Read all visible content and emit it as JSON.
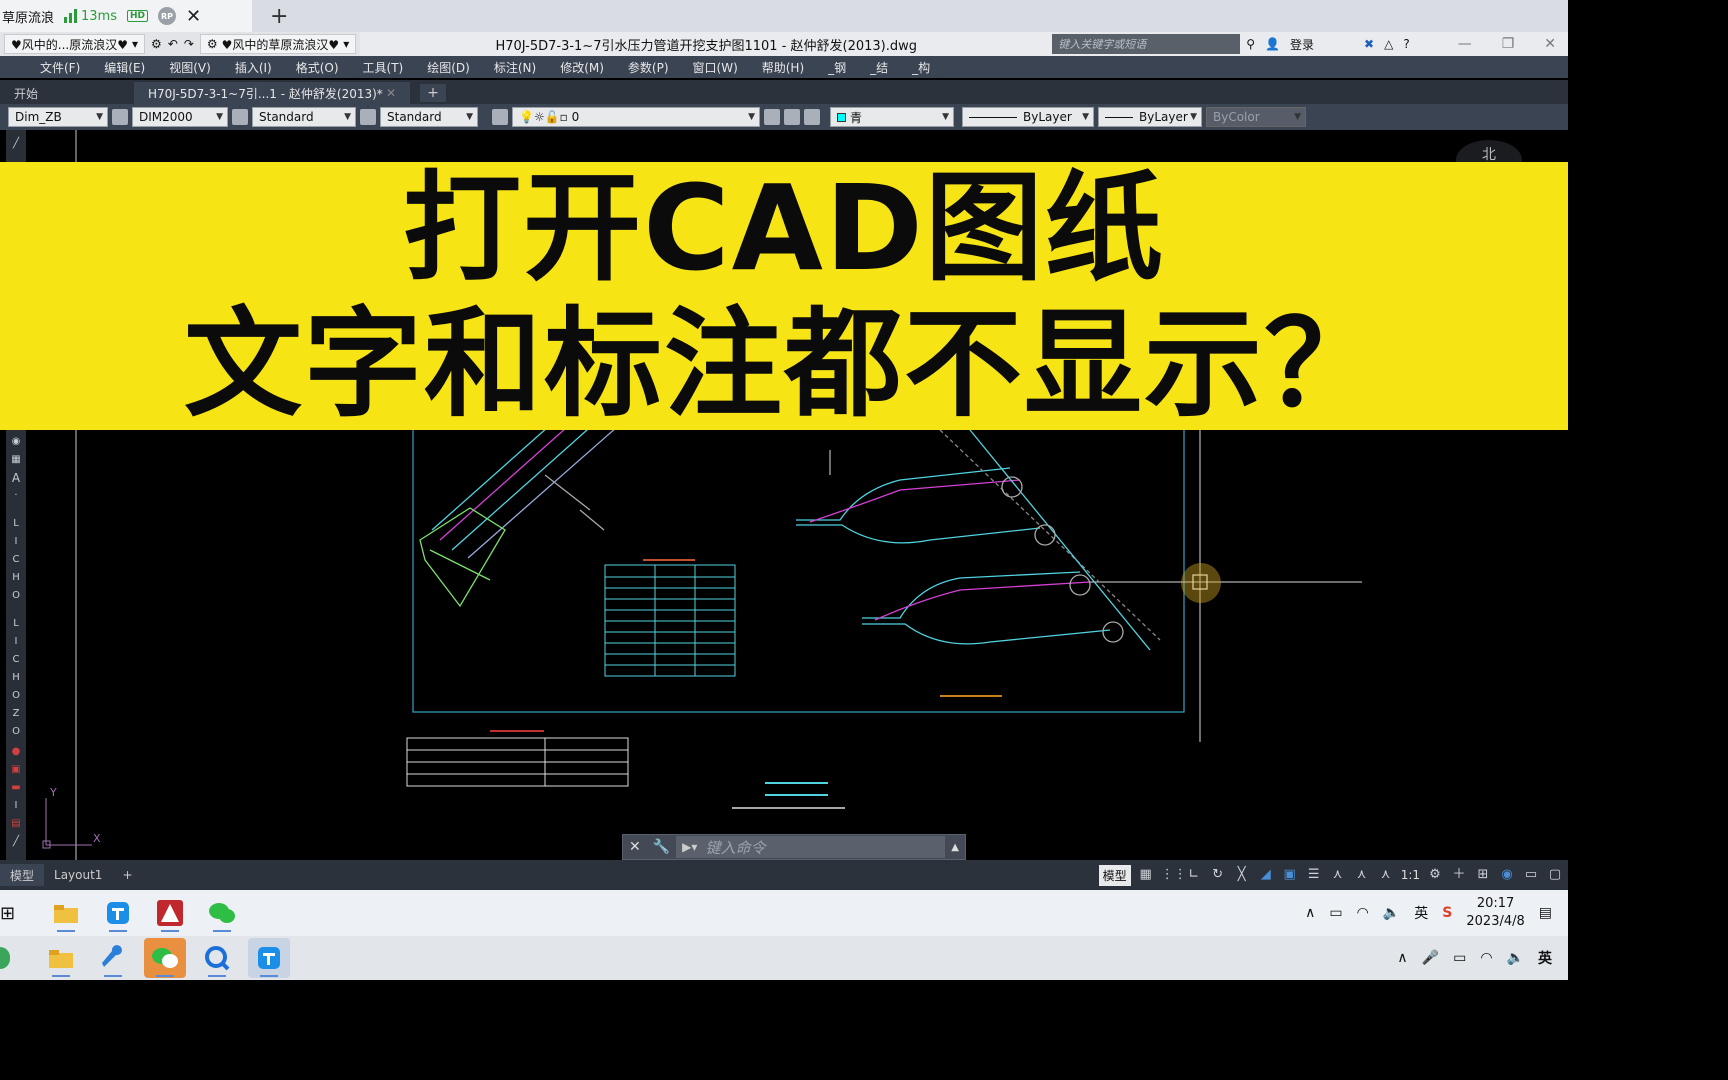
{
  "browser": {
    "tab_title": "草原流浪",
    "ping": "13ms",
    "hd": "HD",
    "rp": "RP"
  },
  "titlebar": {
    "workspace_left": "♥风中的...原流浪汉♥",
    "workspace": "♥风中的草原流浪汉♥",
    "document_title": "H70J-5D7-3-1~7引水压力管道开挖支护图1101 - 赵仲舒发(2013).dwg",
    "search_placeholder": "键入关键字或短语",
    "login": "登录"
  },
  "menu": {
    "items": [
      "文件(F)",
      "编辑(E)",
      "视图(V)",
      "插入(I)",
      "格式(O)",
      "工具(T)",
      "绘图(D)",
      "标注(N)",
      "修改(M)",
      "参数(P)",
      "窗口(W)",
      "帮助(H)",
      "_钢",
      "_结",
      "_构"
    ]
  },
  "doc_tabs": {
    "start": "开始",
    "active": "H70J-5D7-3-1~7引...1 - 赵仲舒发(2013)*"
  },
  "properties": {
    "dim_style_layer": "Dim_ZB",
    "dim_style": "DIM2000",
    "text_style": "Standard",
    "table_style": "Standard",
    "layer": "0",
    "color": "青",
    "linetype": "ByLayer",
    "lineweight": "ByLayer",
    "plot_style": "ByColor"
  },
  "compass": {
    "north": "北"
  },
  "banner": {
    "line1": "打开CAD图纸",
    "line2": "文字和标注都不显示？",
    "color": "#f7e415"
  },
  "command": {
    "placeholder": "键入命令"
  },
  "layout_tabs": {
    "model": "模型",
    "layout1": "Layout1"
  },
  "status": {
    "model_label": "模型",
    "scale": "1:1"
  },
  "taskbar": {
    "ime": "英",
    "time": "20:17",
    "date": "2023/4/8",
    "ime2": "英"
  }
}
